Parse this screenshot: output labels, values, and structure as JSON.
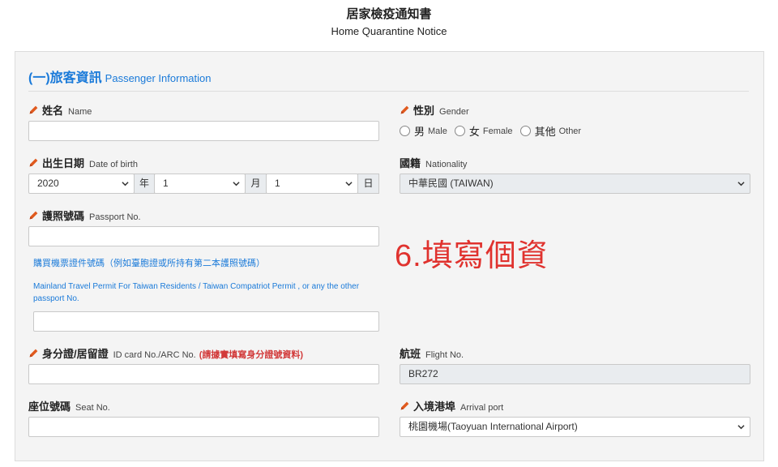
{
  "header": {
    "title": "居家檢疫通知書",
    "subtitle": "Home Quarantine Notice"
  },
  "section": {
    "title_zh": "(一)旅客資訊",
    "title_en": "Passenger Information"
  },
  "fields": {
    "name": {
      "label_zh": "姓名",
      "label_en": "Name",
      "value": ""
    },
    "gender": {
      "label_zh": "性別",
      "label_en": "Gender",
      "options": [
        {
          "zh": "男",
          "en": "Male"
        },
        {
          "zh": "女",
          "en": "Female"
        },
        {
          "zh": "其他",
          "en": "Other"
        }
      ]
    },
    "dob": {
      "label_zh": "出生日期",
      "label_en": "Date of birth",
      "year": "2020",
      "year_unit": "年",
      "month": "1",
      "month_unit": "月",
      "day": "1",
      "day_unit": "日"
    },
    "nationality": {
      "label_zh": "國籍",
      "label_en": "Nationality",
      "value": "中華民國 (TAIWAN)"
    },
    "passport": {
      "label_zh": "護照號碼",
      "label_en": "Passport No.",
      "value": ""
    },
    "alt_doc": {
      "hint_zh": "購買機票證件號碼（例如臺胞證或所持有第二本護照號碼）",
      "hint_en": "Mainland Travel Permit For Taiwan Residents / Taiwan Compatriot Permit , or any the other passport No.",
      "value": ""
    },
    "id_card": {
      "label_zh": "身分證/居留證",
      "label_en": "ID card No./ARC No.",
      "warning": "(請據實填寫身分證號資料)",
      "value": ""
    },
    "flight": {
      "label_zh": "航班",
      "label_en": "Flight No.",
      "value": "BR272"
    },
    "seat": {
      "label_zh": "座位號碼",
      "label_en": "Seat No.",
      "value": ""
    },
    "arrival_port": {
      "label_zh": "入境港埠",
      "label_en": "Arrival port",
      "value": "桃園機場(Taoyuan International Airport)"
    }
  },
  "annotation": "6.填寫個資",
  "colors": {
    "accent": "#1a7ad9",
    "warning": "#d23a3a",
    "annotation": "#e0322e",
    "pencil": "#e05a1e"
  }
}
